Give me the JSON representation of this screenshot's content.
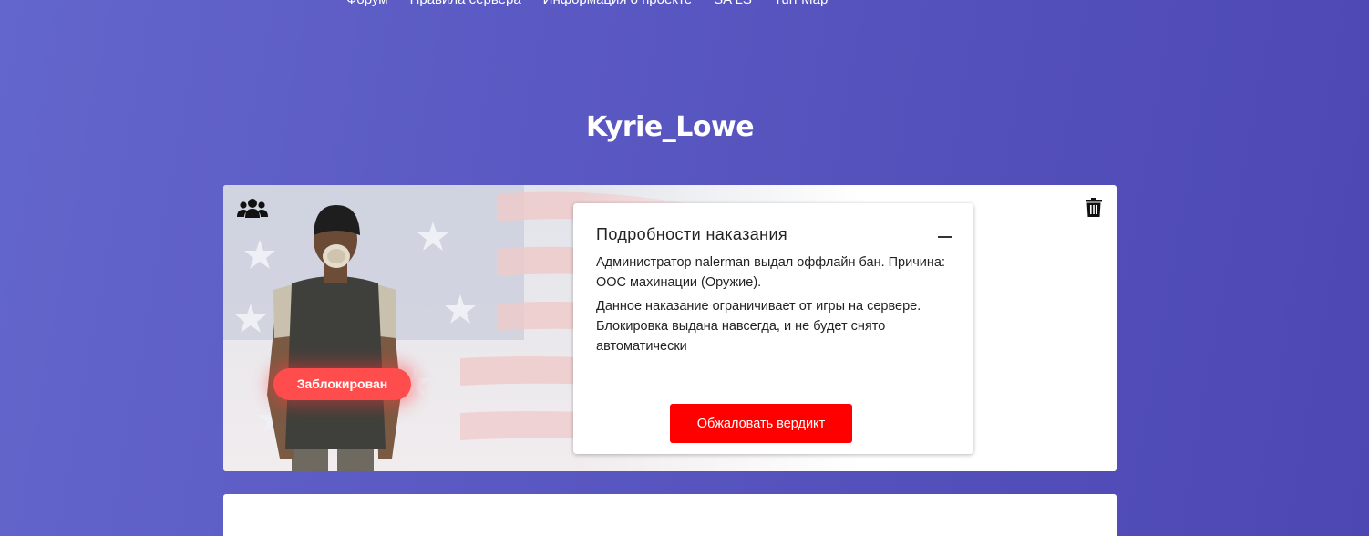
{
  "nav": {
    "items": [
      {
        "label": "Форум"
      },
      {
        "label": "Правила сервера"
      },
      {
        "label": "Информация о проекте"
      },
      {
        "label": "SA LS"
      },
      {
        "label": "Turf Map"
      }
    ]
  },
  "profile": {
    "name": "Kyrie_Lowe",
    "status": "Заблокирован"
  },
  "punishment": {
    "title": "Подробности наказания",
    "line1": "Администратор nalerman выдал оффлайн бан. Причина: ООС махинации (Оружие).",
    "line2": "Данное наказание ограничивает от игры на сервере. Блокировка выдана навсегда, и не будет снято автоматически",
    "appeal_button": "Обжаловать вердикт"
  },
  "colors": {
    "background": "#5a58c2",
    "status_badge": "#ff4d4d",
    "appeal_button": "#ff0000"
  },
  "icons": {
    "group": "users-icon",
    "delete": "trash-icon",
    "collapse": "minus-icon"
  }
}
